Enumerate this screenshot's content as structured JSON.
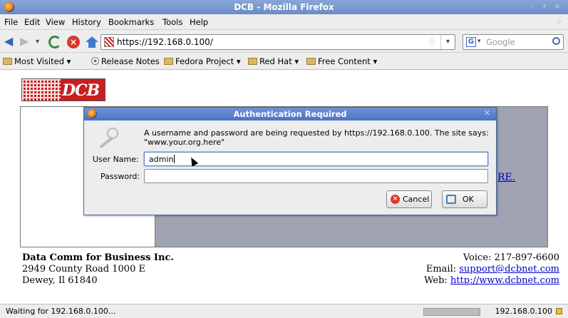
{
  "window": {
    "title": "DCB - Mozilla Firefox"
  },
  "menu": {
    "items": [
      "File",
      "Edit",
      "View",
      "History",
      "Bookmarks",
      "Tools",
      "Help"
    ]
  },
  "nav": {
    "url": "https://192.168.0.100/",
    "search_placeholder": "Google"
  },
  "bookmarks": {
    "items": [
      "Most Visited",
      "Release Notes",
      "Fedora Project",
      "Red Hat",
      "Free Content"
    ]
  },
  "page": {
    "logo_text": "DCB",
    "link_partial": "RE.",
    "footer_left": {
      "company": "Data Comm for Business Inc.",
      "address1": "2949 County Road 1000 E",
      "address2": "Dewey, Il 61840"
    },
    "footer_right": {
      "voice_label": "Voice: 217-897-6600",
      "email_label": "Email: ",
      "email": "support@dcbnet.com",
      "web_label": "Web: ",
      "web": "http://www.dcbnet.com"
    }
  },
  "dialog": {
    "title": "Authentication Required",
    "message": "A username and password are being requested by https://192.168.0.100. The site says: \"www.your.org.here\"",
    "username_label": "User Name:",
    "username_value": "admin",
    "password_label": "Password:",
    "password_value": "",
    "cancel_label": "Cancel",
    "ok_label": "OK"
  },
  "status": {
    "text": "Waiting for 192.168.0.100...",
    "host": "192.168.0.100"
  }
}
